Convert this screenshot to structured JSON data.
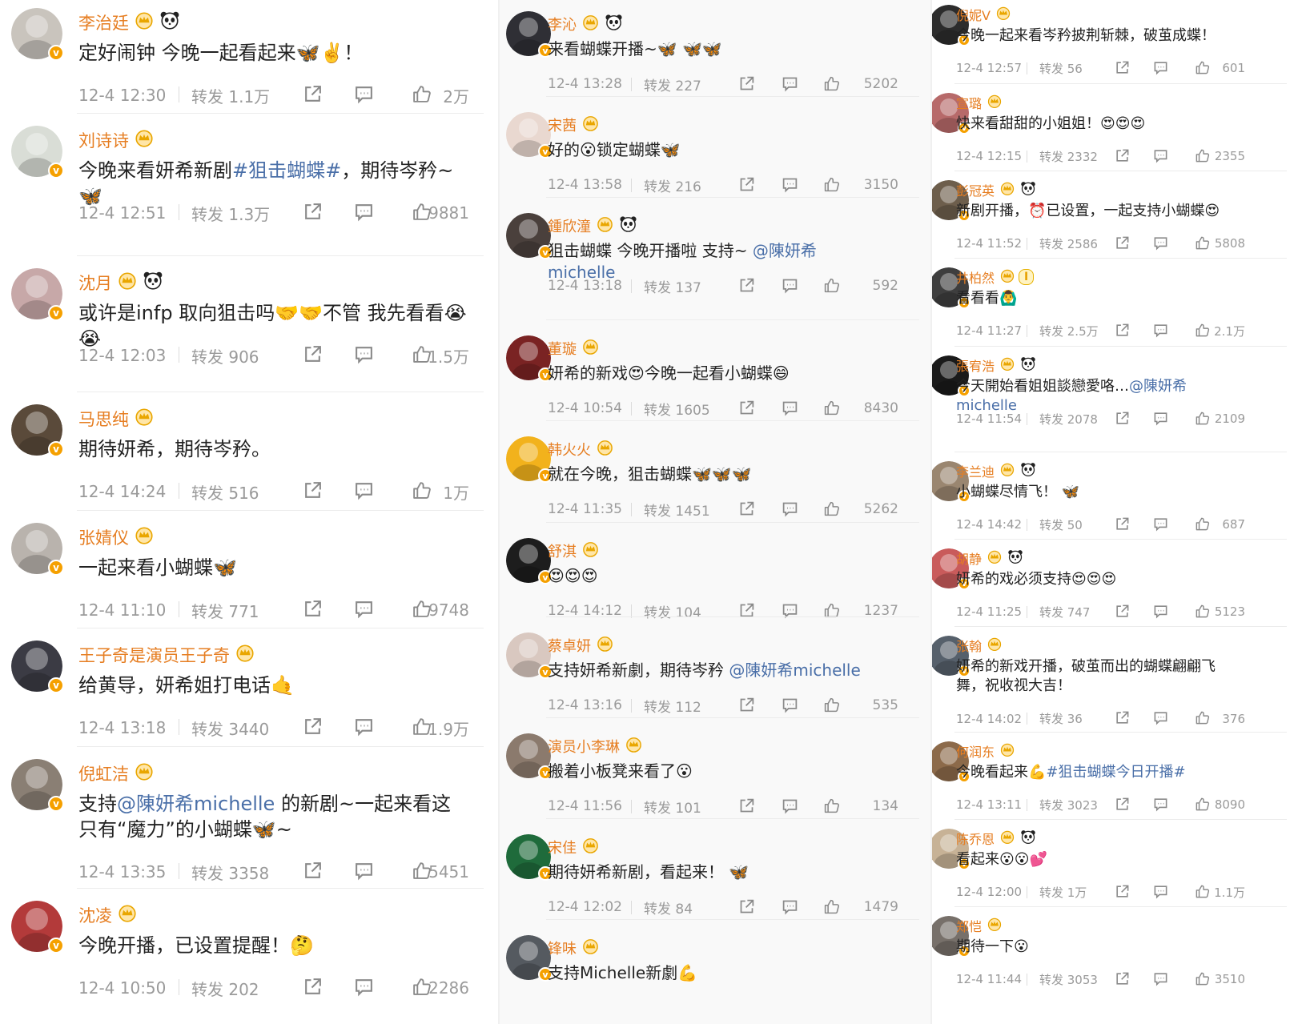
{
  "colors": {
    "username": "#e67e22",
    "link": "#4a6fa8",
    "meta": "#9a9a9a",
    "badge": "#f5a000"
  },
  "columns": [
    {
      "posts": [
        {
          "name": "李治廷",
          "badges": [
            "crown",
            "panda"
          ],
          "text": "定好闹钟 今晚一起看起来🦋✌️！",
          "time": "12-4 12:30",
          "forward": "转发 1.1万",
          "likes": "2万",
          "avatar_color": "#c9c4bd"
        },
        {
          "name": "刘诗诗",
          "badges": [
            "crown"
          ],
          "text": "今晚来看妍希新剧#狙击蝴蝶#，期待岑矜~🦋",
          "time": "12-4 12:51",
          "forward": "转发 1.3万",
          "likes": "9881",
          "avatar_color": "#d9ddd6"
        },
        {
          "name": "沈月",
          "badges": [
            "crown",
            "panda"
          ],
          "text": "或许是infp 取向狙击吗🤝🤝不管 我先看看😭😭",
          "time": "12-4 12:03",
          "forward": "转发 906",
          "likes": "1.5万",
          "avatar_color": "#c7a8a8"
        },
        {
          "name": "马思纯",
          "badges": [
            "crown"
          ],
          "text": "期待妍希，期待岑矜。",
          "time": "12-4 14:24",
          "forward": "转发 516",
          "likes": "1万",
          "avatar_color": "#5a4a3a"
        },
        {
          "name": "张婧仪",
          "badges": [
            "crown"
          ],
          "text": "一起来看小蝴蝶🦋",
          "time": "12-4 11:10",
          "forward": "转发 771",
          "likes": "9748",
          "avatar_color": "#b9b3ad"
        },
        {
          "name": "王子奇是演员王子奇",
          "badges": [
            "crown"
          ],
          "text": "给黄导，妍希姐打电话🤙",
          "time": "12-4 13:18",
          "forward": "转发 3440",
          "likes": "1.9万",
          "avatar_color": "#3b3b44"
        },
        {
          "name": "倪虹洁",
          "badges": [
            "crown"
          ],
          "text": "支持@陳妍希michelle 的新剧~一起来看这只有“魔力”的小蝴蝶🦋~",
          "time": "12-4 13:35",
          "forward": "转发 3358",
          "likes": "5451",
          "avatar_color": "#8a7f74"
        },
        {
          "name": "沈凌",
          "badges": [
            "crown"
          ],
          "text": "今晚开播，已设置提醒！🤔",
          "time": "12-4 10:50",
          "forward": "转发 202",
          "likes": "2286",
          "avatar_color": "#b33a3a"
        }
      ]
    },
    {
      "posts": [
        {
          "name": "李沁",
          "badges": [
            "crown",
            "panda"
          ],
          "text": "来看蝴蝶开播~🦋 🦋🦋",
          "time": "12-4 13:28",
          "forward": "转发 227",
          "likes": "5202",
          "avatar_color": "#2f2f35"
        },
        {
          "name": "宋茜",
          "badges": [
            "crown"
          ],
          "text": "好的😮锁定蝴蝶🦋",
          "time": "12-4 13:58",
          "forward": "转发 216",
          "likes": "3150",
          "avatar_color": "#e9d8d0"
        },
        {
          "name": "鍾欣潼",
          "badges": [
            "crown",
            "panda"
          ],
          "text": "狙击蝴蝶 今晚开播啦 支持~ @陳妍希michelle",
          "time": "12-4 13:18",
          "forward": "转发 137",
          "likes": "592",
          "avatar_color": "#4a403c"
        },
        {
          "name": "董璇",
          "badges": [
            "crown"
          ],
          "text": "妍希的新戏😍今晚一起看小蝴蝶😄",
          "time": "12-4 10:54",
          "forward": "转发 1605",
          "likes": "8430",
          "avatar_color": "#7a2323"
        },
        {
          "name": "韩火火",
          "badges": [
            "crown"
          ],
          "text": "就在今晚，狙击蝴蝶🦋🦋🦋",
          "time": "12-4 11:35",
          "forward": "转发 1451",
          "likes": "5262",
          "avatar_color": "#f2b21c"
        },
        {
          "name": "舒淇",
          "badges": [
            "crown"
          ],
          "text": "😍😍😍",
          "time": "12-4 14:12",
          "forward": "转发 104",
          "likes": "1237",
          "avatar_color": "#1d1d1d"
        },
        {
          "name": "蔡卓妍",
          "badges": [
            "crown"
          ],
          "text": "支持妍希新劇，期待岑矜 @陳妍希michelle",
          "time": "12-4 13:16",
          "forward": "转发 112",
          "likes": "535",
          "avatar_color": "#d9c8c0"
        },
        {
          "name": "演员小李琳",
          "badges": [
            "crown"
          ],
          "text": "搬着小板凳来看了😮",
          "time": "12-4 11:56",
          "forward": "转发 101",
          "likes": "134",
          "avatar_color": "#8b7a6d"
        },
        {
          "name": "宋佳",
          "badges": [
            "crown"
          ],
          "text": "期待妍希新剧，看起来！ 🦋",
          "time": "12-4 12:02",
          "forward": "转发 84",
          "likes": "1479",
          "avatar_color": "#1f6b3b"
        },
        {
          "name": "锋味",
          "badges": [
            "crown"
          ],
          "text": "支持Michelle新劇💪",
          "time": "",
          "forward": "",
          "likes": "",
          "avatar_color": "#555a60"
        }
      ]
    },
    {
      "posts": [
        {
          "name": "倪妮V",
          "badges": [
            "crown"
          ],
          "text": "今晚一起来看岑矜披荆斩棘，破茧成蝶！",
          "time": "12-4 12:57",
          "forward": "转发 56",
          "likes": "601",
          "avatar_color": "#2c2c2c"
        },
        {
          "name": "宣璐",
          "badges": [
            "crown"
          ],
          "text": "快来看甜甜的小姐姐！😍😍😍",
          "time": "12-4 12:15",
          "forward": "转发 2332",
          "likes": "2355",
          "avatar_color": "#b76a6a"
        },
        {
          "name": "彭冠英",
          "badges": [
            "crown",
            "panda"
          ],
          "text": "新剧开播，⏰已设置，一起支持小蝴蝶😍",
          "time": "12-4 11:52",
          "forward": "转发 2586",
          "likes": "5808",
          "avatar_color": "#6d5e4c"
        },
        {
          "name": "井柏然",
          "badges": [
            "crown",
            "vip"
          ],
          "text": "看看看🙆‍♂️",
          "time": "12-4 11:27",
          "forward": "转发 2.5万",
          "likes": "2.1万",
          "avatar_color": "#3e3e3e"
        },
        {
          "name": "張宥浩",
          "badges": [
            "crown",
            "panda"
          ],
          "text": "今天開始看姐姐談戀愛咯…@陳妍希michelle",
          "time": "12-4 11:54",
          "forward": "转发 2078",
          "likes": "2109",
          "avatar_color": "#1a1a1a"
        },
        {
          "name": "李兰迪",
          "badges": [
            "crown",
            "panda"
          ],
          "text": "小蝴蝶尽情飞！ 🦋",
          "time": "12-4 14:42",
          "forward": "转发 50",
          "likes": "687",
          "avatar_color": "#9a8670"
        },
        {
          "name": "胡静",
          "badges": [
            "crown",
            "panda"
          ],
          "text": "妍希的戏必须支持😍😍😍",
          "time": "12-4 11:25",
          "forward": "转发 747",
          "likes": "5123",
          "avatar_color": "#c95b5b"
        },
        {
          "name": "张翰",
          "badges": [
            "crown"
          ],
          "text": "妍希的新戏开播，破茧而出的蝴蝶翩翩飞舞，祝收视大吉！",
          "time": "12-4 14:02",
          "forward": "转发 36",
          "likes": "376",
          "avatar_color": "#56606b"
        },
        {
          "name": "何润东",
          "badges": [
            "crown"
          ],
          "text": "今晚看起来💪#狙击蝴蝶今日开播#",
          "time": "12-4 13:11",
          "forward": "转发 3023",
          "likes": "8090",
          "avatar_color": "#8c6a4a"
        },
        {
          "name": "陈乔恩",
          "badges": [
            "crown",
            "panda"
          ],
          "text": "看起来😮😮💕",
          "time": "12-4 12:00",
          "forward": "转发 1万",
          "likes": "1.1万",
          "avatar_color": "#c7b296"
        },
        {
          "name": "郑恺",
          "badges": [
            "crown"
          ],
          "text": "期待一下😮",
          "time": "12-4 11:44",
          "forward": "转发 3053",
          "likes": "3510",
          "avatar_color": "#77706a"
        }
      ]
    }
  ],
  "icons": {
    "verified": "verified-v-badge",
    "crown": "crown-icon",
    "panda": "panda-icon",
    "share": "share-icon",
    "comment": "comment-icon",
    "like": "thumbs-up-icon"
  }
}
